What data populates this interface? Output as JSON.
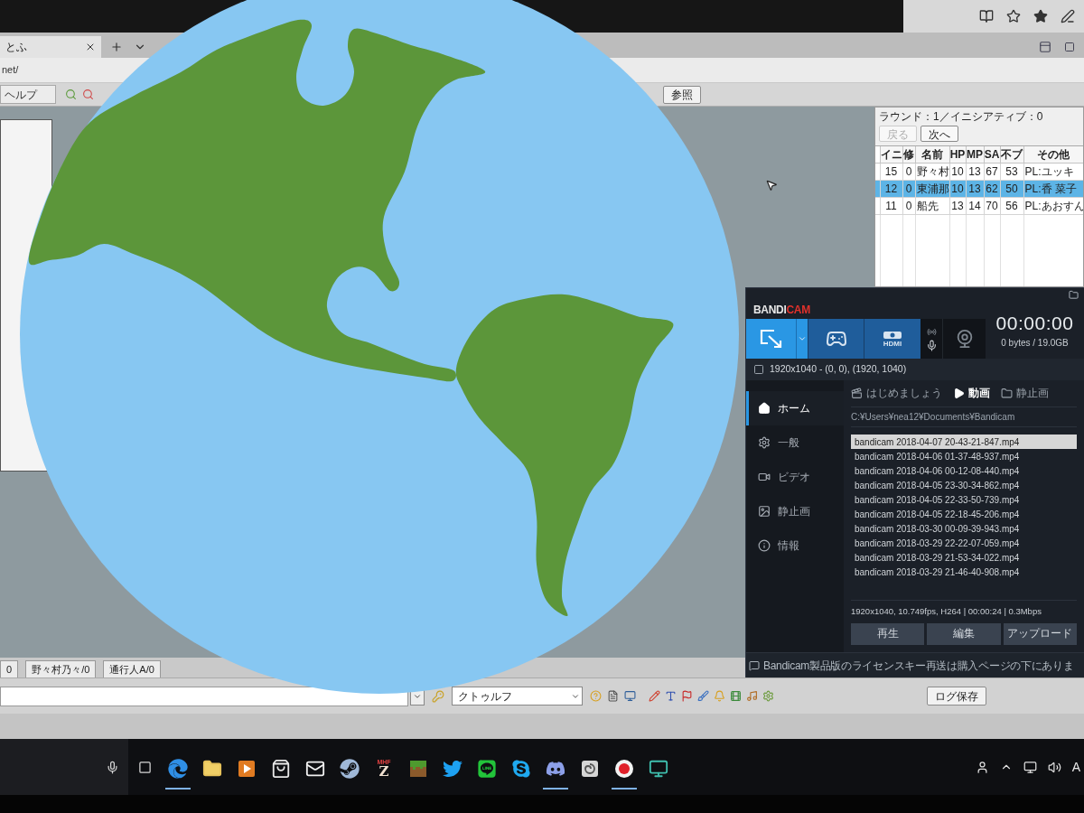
{
  "browser": {
    "tab": {
      "title": "とふ"
    },
    "address": "net/"
  },
  "app_menu": {
    "menu": "ヘルプ",
    "button": "参照"
  },
  "initiative": {
    "status": "ラウンド：1／イニシアティブ：0",
    "buttons": [
      {
        "label": "戻る",
        "disabled": true
      },
      {
        "label": "次へ",
        "disabled": false
      }
    ],
    "columns": [
      "イニ",
      "修",
      "名前",
      "HP",
      "MP",
      "SA",
      "不ブ",
      "その他"
    ],
    "rows": [
      {
        "cells": [
          "15",
          "0",
          "野々村",
          "10",
          "13",
          "67",
          "53",
          "PL:ユッキ"
        ],
        "selected": false
      },
      {
        "cells": [
          "12",
          "0",
          "東浦那",
          "10",
          "13",
          "62",
          "50",
          "PL:香 菜子"
        ],
        "selected": true
      },
      {
        "cells": [
          "11",
          "0",
          "船先",
          "13",
          "14",
          "70",
          "56",
          "PL:あおすん"
        ],
        "selected": false
      }
    ]
  },
  "bandicam": {
    "logo": [
      "BANDI",
      "CAM"
    ],
    "modes": [
      {
        "kind": "screen",
        "selected": true
      },
      {
        "kind": "game",
        "selected": false
      },
      {
        "kind": "device",
        "selected": false,
        "label": "HDMI"
      }
    ],
    "timer": "00:00:00",
    "size": "0 bytes / 19.0GB",
    "region": "1920x1040 - (0, 0), (1920, 1040)",
    "nav": [
      {
        "kind": "home",
        "label": "ホーム",
        "selected": true
      },
      {
        "kind": "general",
        "label": "一般",
        "selected": false
      },
      {
        "kind": "video",
        "label": "ビデオ",
        "selected": false
      },
      {
        "kind": "image",
        "label": "静止画",
        "selected": false
      },
      {
        "kind": "info",
        "label": "情報",
        "selected": false
      }
    ],
    "tabs": [
      {
        "kind": "start",
        "label": "はじめましょう",
        "selected": false
      },
      {
        "kind": "video",
        "label": "動画",
        "selected": true
      },
      {
        "kind": "image",
        "label": "静止画",
        "selected": false
      }
    ],
    "path": "C:¥Users¥nea12¥Documents¥Bandicam",
    "files": [
      {
        "name": "bandicam 2018-04-07 20-43-21-847.mp4",
        "selected": true
      },
      {
        "name": "bandicam 2018-04-06 01-37-48-937.mp4",
        "selected": false
      },
      {
        "name": "bandicam 2018-04-06 00-12-08-440.mp4",
        "selected": false
      },
      {
        "name": "bandicam 2018-04-05 23-30-34-862.mp4",
        "selected": false
      },
      {
        "name": "bandicam 2018-04-05 22-33-50-739.mp4",
        "selected": false
      },
      {
        "name": "bandicam 2018-04-05 22-18-45-206.mp4",
        "selected": false
      },
      {
        "name": "bandicam 2018-03-30 00-09-39-943.mp4",
        "selected": false
      },
      {
        "name": "bandicam 2018-03-29 22-22-07-059.mp4",
        "selected": false
      },
      {
        "name": "bandicam 2018-03-29 21-53-34-022.mp4",
        "selected": false
      },
      {
        "name": "bandicam 2018-03-29 21-46-40-908.mp4",
        "selected": false
      }
    ],
    "info": "1920x1040, 10.749fps, H264 | 00:00:24 | 0.3Mbps",
    "actions": [
      "再生",
      "編集",
      "アップロード"
    ],
    "notice": "Bandicam製品版のライセンスキー再送は購入ページの下にありま"
  },
  "chat": {
    "tabs": [
      "0",
      "野々村乃々/0",
      "通行人A/0"
    ],
    "game_system": "クトゥルフ",
    "save_button": "ログ保存"
  },
  "taskbar": {
    "apps": [
      {
        "kind": "edge",
        "running": true
      },
      {
        "kind": "explorer",
        "running": false
      },
      {
        "kind": "media",
        "running": false
      },
      {
        "kind": "store",
        "running": false
      },
      {
        "kind": "mail",
        "running": false
      },
      {
        "kind": "steam",
        "running": false
      },
      {
        "kind": "mhf",
        "running": false,
        "text": [
          "MHF",
          "Z"
        ]
      },
      {
        "kind": "minecraft",
        "running": false
      },
      {
        "kind": "twitter",
        "running": false
      },
      {
        "kind": "line",
        "running": false
      },
      {
        "kind": "skype",
        "running": false
      },
      {
        "kind": "discord",
        "running": true
      },
      {
        "kind": "swirl",
        "running": false
      },
      {
        "kind": "recorder",
        "running": true
      },
      {
        "kind": "remote",
        "running": false
      }
    ],
    "tray": {
      "ime": "A"
    }
  }
}
